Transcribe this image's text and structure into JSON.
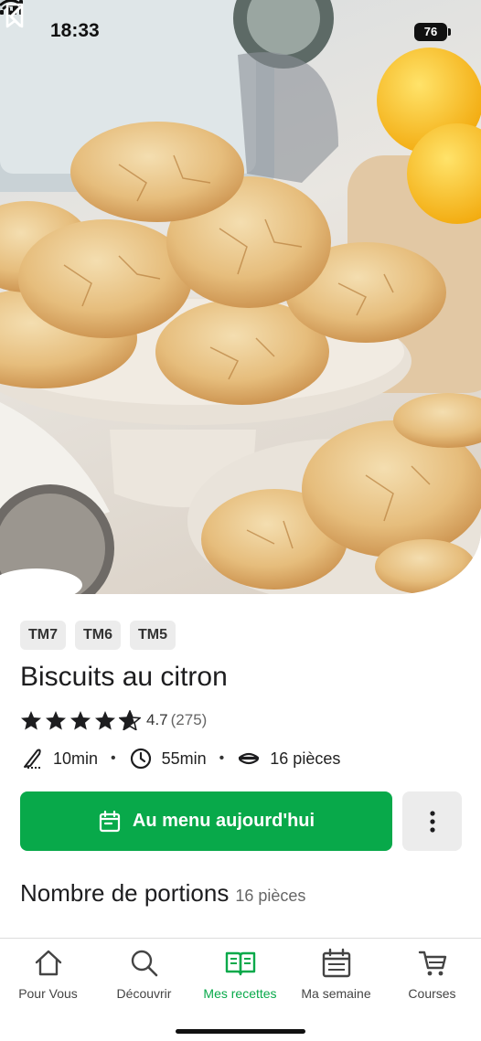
{
  "status_bar": {
    "time": "18:33",
    "battery": "76"
  },
  "hero": {
    "image_subject": "lemon crinkle cookies on cake stand"
  },
  "tags": [
    "TM7",
    "TM6",
    "TM5"
  ],
  "recipe": {
    "title": "Biscuits au citron",
    "rating": "4.7",
    "rating_count": "(275)",
    "stars_filled": 4.5,
    "prep_time": "10min",
    "total_time": "55min",
    "yield": "16 pièces"
  },
  "cta": {
    "label": "Au menu aujourd'hui"
  },
  "portions": {
    "label": "Nombre de portions",
    "value": "16 pièces"
  },
  "tabbar": {
    "items": [
      {
        "label": "Pour Vous",
        "icon": "home-icon"
      },
      {
        "label": "Découvrir",
        "icon": "search-icon"
      },
      {
        "label": "Mes recettes",
        "icon": "book-icon",
        "active": true
      },
      {
        "label": "Ma semaine",
        "icon": "calendar-icon"
      },
      {
        "label": "Courses",
        "icon": "cart-icon"
      }
    ]
  },
  "colors": {
    "accent": "#08a94a",
    "tag_bg": "#ececec",
    "text": "#1d1d1f"
  }
}
